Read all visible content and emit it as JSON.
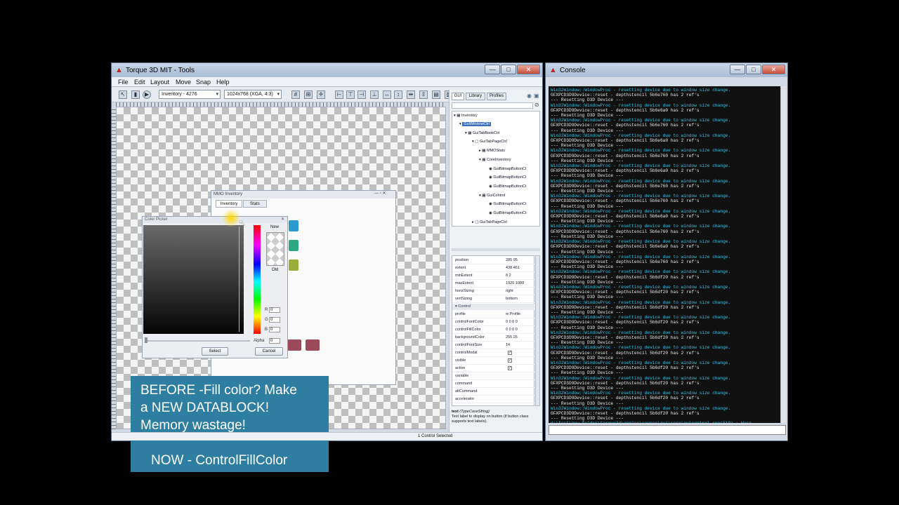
{
  "tools_window": {
    "title": "Torque 3D MIT - Tools",
    "menu": [
      "File",
      "Edit",
      "Layout",
      "Move",
      "Snap",
      "Help"
    ],
    "gui_select": "Inventory - 4276",
    "resolution_select": "1024x768 (XGA, 4:3)",
    "status": "1 Control Selected"
  },
  "mmo_window": {
    "title": "MMO Inventory",
    "tabs": [
      "Inventory",
      "Stats"
    ]
  },
  "color_picker": {
    "title": "Color Picker",
    "new_label": "New",
    "old_label": "Old",
    "r_label": "R",
    "g_label": "G",
    "b_label": "B",
    "r_value": "0",
    "g_value": "0",
    "b_value": "0",
    "alpha_label": "Alpha",
    "alpha_value": "0",
    "select_label": "Select",
    "cancel_label": "Cancel"
  },
  "overlay": {
    "line1": "BEFORE -Fill color? Make",
    "line2": "a NEW DATABLOCK!",
    "line3": "Memory wastage!",
    "line4": "NOW - ControlFillColor"
  },
  "right_panel": {
    "tabs": [
      "GUI",
      "Library",
      "Profiles"
    ],
    "tree": [
      "Inventory",
      "GuiWindowCtrl",
      "GuiTabBookCtrl",
      "GuiTabPageCtrl",
      "MMOStats",
      "CoreInventory",
      "GuiBitmapButtonCt",
      "GuiBitmapButtonCt",
      "GuiBitmapButtonCt",
      "GuiControl",
      "GuiBitmapButtonCt",
      "GuiBitmapButtonCt",
      "GuiTabPageCtrl"
    ],
    "props_top": [
      {
        "name": "position",
        "value": "285 95"
      },
      {
        "name": "extent",
        "value": "438 461"
      },
      {
        "name": "minExtent",
        "value": "8 2"
      },
      {
        "name": "maxExtent",
        "value": "1920 1080"
      },
      {
        "name": "horizSizing",
        "value": "right"
      },
      {
        "name": "vertSizing",
        "value": "bottom"
      }
    ],
    "section_control": "Control",
    "props_control": [
      {
        "name": "profile",
        "value": "w Profile"
      },
      {
        "name": "controlFontColor",
        "value": "0 0 0 0"
      },
      {
        "name": "controlFillColor",
        "value": "0 0 0 0"
      },
      {
        "name": "backgroundColor",
        "value": "255 25"
      },
      {
        "name": "controlFontSize",
        "value": "14"
      }
    ],
    "props_bool": [
      "controlModal",
      "visible",
      "active"
    ],
    "props_empty": [
      "variable",
      "command",
      "altCommand",
      "accelerator"
    ],
    "help_title": "text",
    "help_type": "(TypeCaseString)",
    "help_text": "Text label to display on button (if button class supports text labels)."
  },
  "console_window": {
    "title": "Console",
    "lines": [
      "Win32Window::WindowProc - resetting device due to window size change.",
      "GFXPCD3D9Device::reset - depthstencil 5b6e760 has 2 ref's",
      "--- Resetting D3D Device ---",
      "Win32Window::WindowProc - resetting device due to window size change.",
      "GFXPCD3D9Device::reset - depthstencil 5b6e6a0 has 2 ref's",
      "--- Resetting D3D Device ---",
      "Win32Window::WindowProc - resetting device due to window size change.",
      "GFXPCD3D9Device::reset - depthstencil 5b6e760 has 2 ref's",
      "--- Resetting D3D Device ---",
      "Win32Window::WindowProc - resetting device due to window size change.",
      "GFXPCD3D9Device::reset - depthstencil 5b6e6a0 has 2 ref's",
      "--- Resetting D3D Device ---",
      "Win32Window::WindowProc - resetting device due to window size change.",
      "GFXPCD3D9Device::reset - depthstencil 5b6e760 has 2 ref's",
      "--- Resetting D3D Device ---",
      "Win32Window::WindowProc - resetting device due to window size change.",
      "GFXPCD3D9Device::reset - depthstencil 5b6e6a0 has 2 ref's",
      "--- Resetting D3D Device ---",
      "Win32Window::WindowProc - resetting device due to window size change.",
      "GFXPCD3D9Device::reset - depthstencil 5b6e760 has 2 ref's",
      "--- Resetting D3D Device ---",
      "Win32Window::WindowProc - resetting device due to window size change.",
      "GFXPCD3D9Device::reset - depthstencil 5b6e760 has 2 ref's",
      "--- Resetting D3D Device ---",
      "Win32Window::WindowProc - resetting device due to window size change.",
      "GFXPCD3D9Device::reset - depthstencil 5b6e6a0 has 2 ref's",
      "--- Resetting D3D Device ---",
      "Win32Window::WindowProc - resetting device due to window size change.",
      "GFXPCD3D9Device::reset - depthstencil 5b6e760 has 2 ref's",
      "--- Resetting D3D Device ---",
      "Win32Window::WindowProc - resetting device due to window size change.",
      "GFXPCD3D9Device::reset - depthstencil 5b6e6a0 has 2 ref's",
      "--- Resetting D3D Device ---",
      "Win32Window::WindowProc - resetting device due to window size change.",
      "GFXPCD3D9Device::reset - depthstencil 5b6e760 has 2 ref's",
      "--- Resetting D3D Device ---",
      "Win32Window::WindowProc - resetting device due to window size change.",
      "GFXPCD3D9Device::reset - depthstencil 5b6df20 has 2 ref's",
      "--- Resetting D3D Device ---",
      "Win32Window::WindowProc - resetting device due to window size change.",
      "GFXPCD3D9Device::reset - depthstencil 5b6df20 has 2 ref's",
      "--- Resetting D3D Device ---",
      "Win32Window::WindowProc - resetting device due to window size change.",
      "GFXPCD3D9Device::reset - depthstencil 5b6df20 has 2 ref's",
      "--- Resetting D3D Device ---",
      "Win32Window::WindowProc - resetting device due to window size change.",
      "GFXPCD3D9Device::reset - depthstencil 5b6df20 has 2 ref's",
      "--- Resetting D3D Device ---",
      "Win32Window::WindowProc - resetting device due to window size change.",
      "GFXPCD3D9Device::reset - depthstencil 5b6df20 has 2 ref's",
      "--- Resetting D3D Device ---",
      "Win32Window::WindowProc - resetting device due to window size change.",
      "GFXPCD3D9Device::reset - depthstencil 5b6df20 has 2 ref's",
      "--- Resetting D3D Device ---",
      "Win32Window::WindowProc - resetting device due to window size change.",
      "GFXPCD3D9Device::reset - depthstencil 5b6df20 has 2 ref's",
      "--- Resetting D3D Device ---",
      "Win32Window::WindowProc - resetting device due to window size change.",
      "GFXPCD3D9Device::reset - depthstencil 5b6df20 has 2 ref's",
      "--- Resetting D3D Device ---",
      "Win32Window::WindowProc - resetting device due to window size change.",
      "GFXPCD3D9Device::reset - depthstencil 5b6df20 has 2 ref's",
      "--- Resetting D3D Device ---",
      "Win32Window::WindowProc - resetting device due to window size change.",
      "GFXPCD3D9Device::reset - depthstencil 5b6df20 has 2 ref's",
      "--- Resetting D3D Device ---",
      "d:\\test\\new folder\\torque3d\\engine\\source\\gui\\core\\guicontrol.cpp(519) : Warn"
    ],
    "line_colors": {
      "proc": "#2fc3e3",
      "gfx": "#e8e8e8",
      "reset": "#e8e8e8",
      "warn": "#2fc3e3"
    }
  },
  "colors": {
    "overlay": "#2e7ea2",
    "selection": "#3a6fb7",
    "close_button": "#c64f3b"
  }
}
